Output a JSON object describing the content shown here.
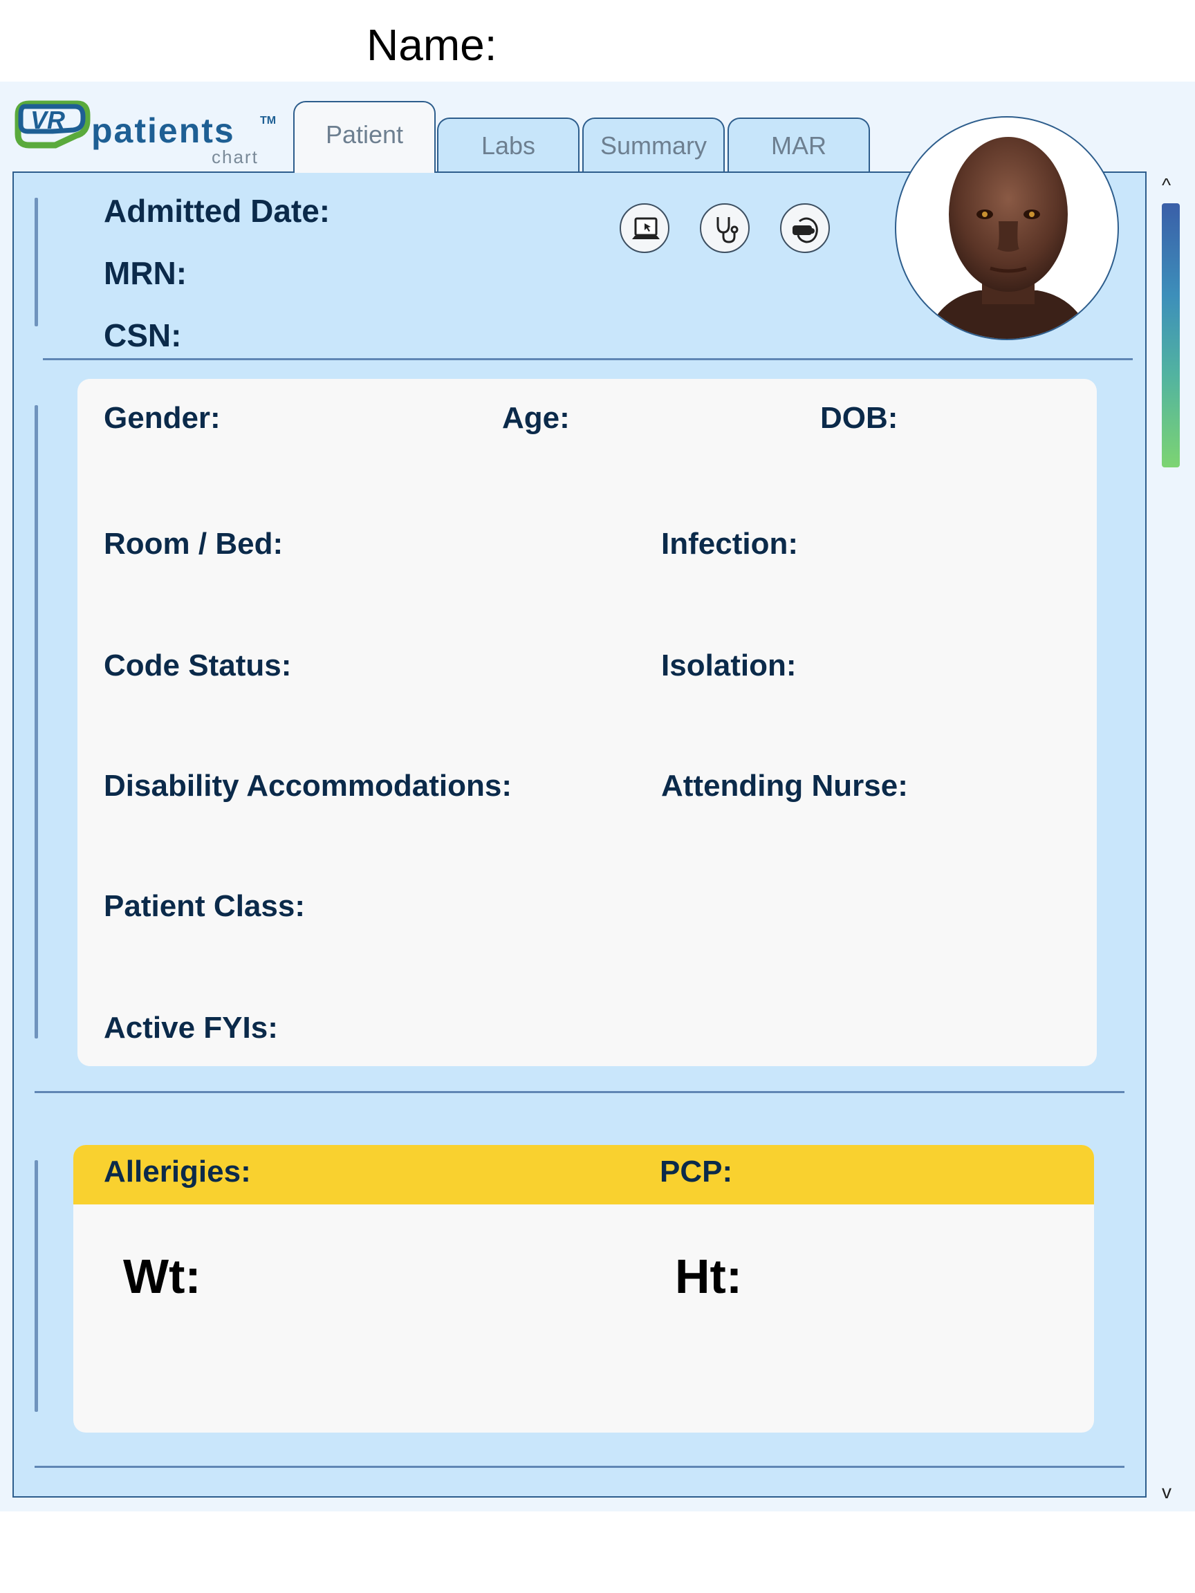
{
  "header": {
    "name_label": "Name:"
  },
  "logo": {
    "word": "patients",
    "tm": "TM",
    "sub": "chart",
    "mark": "VR"
  },
  "tabs": [
    {
      "label": "Patient",
      "active": true
    },
    {
      "label": "Labs",
      "active": false
    },
    {
      "label": "Summary",
      "active": false
    },
    {
      "label": "MAR",
      "active": false
    }
  ],
  "top": {
    "admitted_date": "Admitted Date:",
    "mrn": "MRN:",
    "csn": "CSN:"
  },
  "icons": [
    "laptop-icon",
    "stethoscope-icon",
    "vr-headset-icon"
  ],
  "info": {
    "gender": "Gender:",
    "age": "Age:",
    "dob": "DOB:",
    "room_bed": "Room / Bed:",
    "infection": "Infection:",
    "code_status": "Code Status:",
    "isolation": "Isolation:",
    "disability": "Disability Accommodations:",
    "attending_nurse": "Attending Nurse:",
    "patient_class": "Patient Class:",
    "active_fyis": "Active FYIs:"
  },
  "allergy": {
    "allergies": "Allerigies:",
    "pcp": "PCP:",
    "wt": "Wt:",
    "ht": "Ht:"
  },
  "scrollbar": {
    "up": "^",
    "down": "v"
  },
  "colors": {
    "panel_bg": "#c9e6fb",
    "border": "#2d5d8c",
    "card_bg": "#f8f8f8",
    "allergy_band": "#f9d12f",
    "label_text": "#0b2a4a"
  }
}
